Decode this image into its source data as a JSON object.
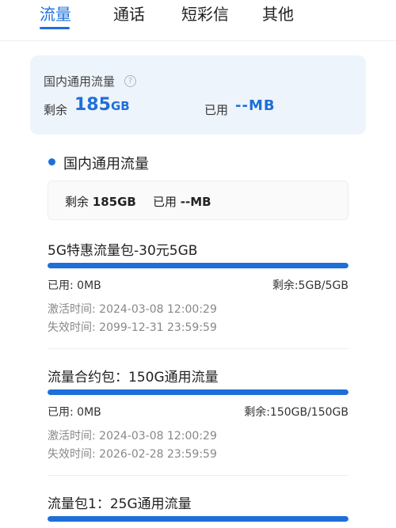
{
  "tabs": [
    {
      "label": "流量",
      "active": true
    },
    {
      "label": "通话",
      "active": false
    },
    {
      "label": "短彩信",
      "active": false
    },
    {
      "label": "其他",
      "active": false
    }
  ],
  "summary": {
    "title": "国内通用流量",
    "help_icon": "question-circle-icon",
    "remain_label": "剩余",
    "remain_value": "185",
    "remain_unit": "GB",
    "used_label": "已用",
    "used_value": "--MB"
  },
  "section": {
    "title": "国内通用流量",
    "remain_label": "剩余",
    "remain_value": "185GB",
    "used_label": "已用",
    "used_value": "--MB"
  },
  "packages": [
    {
      "title": "5G特惠流量包-30元5GB",
      "used": "已用: 0MB",
      "remain": "剩余:5GB/5GB",
      "remain_fraction": 1.0,
      "activated": "激活时间: 2024-03-08 12:00:29",
      "expires": "失效时间: 2099-12-31 23:59:59"
    },
    {
      "title": "流量合约包：150G通用流量",
      "used": "已用: 0MB",
      "remain": "剩余:150GB/150GB",
      "remain_fraction": 1.0,
      "activated": "激活时间: 2024-03-08 12:00:29",
      "expires": "失效时间: 2026-02-28 23:59:59"
    },
    {
      "title": "流量包1：25G通用流量",
      "remain_fraction": 1.0
    }
  ],
  "colors": {
    "accent": "#1e6fd9",
    "bar_bg": "#dfe9f7",
    "summary_bg": "#eef4fb"
  }
}
